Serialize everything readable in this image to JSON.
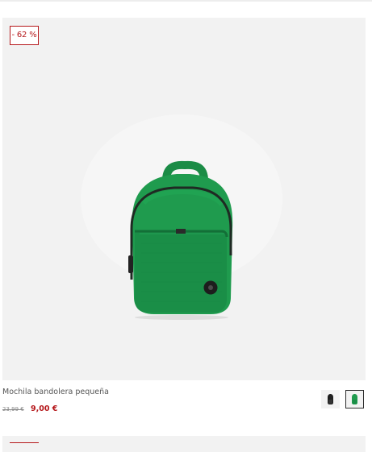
{
  "product": {
    "discount_badge": "- 62 %",
    "name": "Mochila bandolera pequeña",
    "old_price": "23,99 €",
    "new_price": "9,00 €",
    "image_icon": "green-backpack-image",
    "swatches": [
      {
        "color": "#1e1e1e",
        "label": "black"
      },
      {
        "color": "#1f9b4e",
        "label": "green",
        "selected": true
      }
    ]
  },
  "colors": {
    "accent": "#b5171a",
    "image_background": "#f2f2f2",
    "product_green": "#1f9b4e"
  }
}
